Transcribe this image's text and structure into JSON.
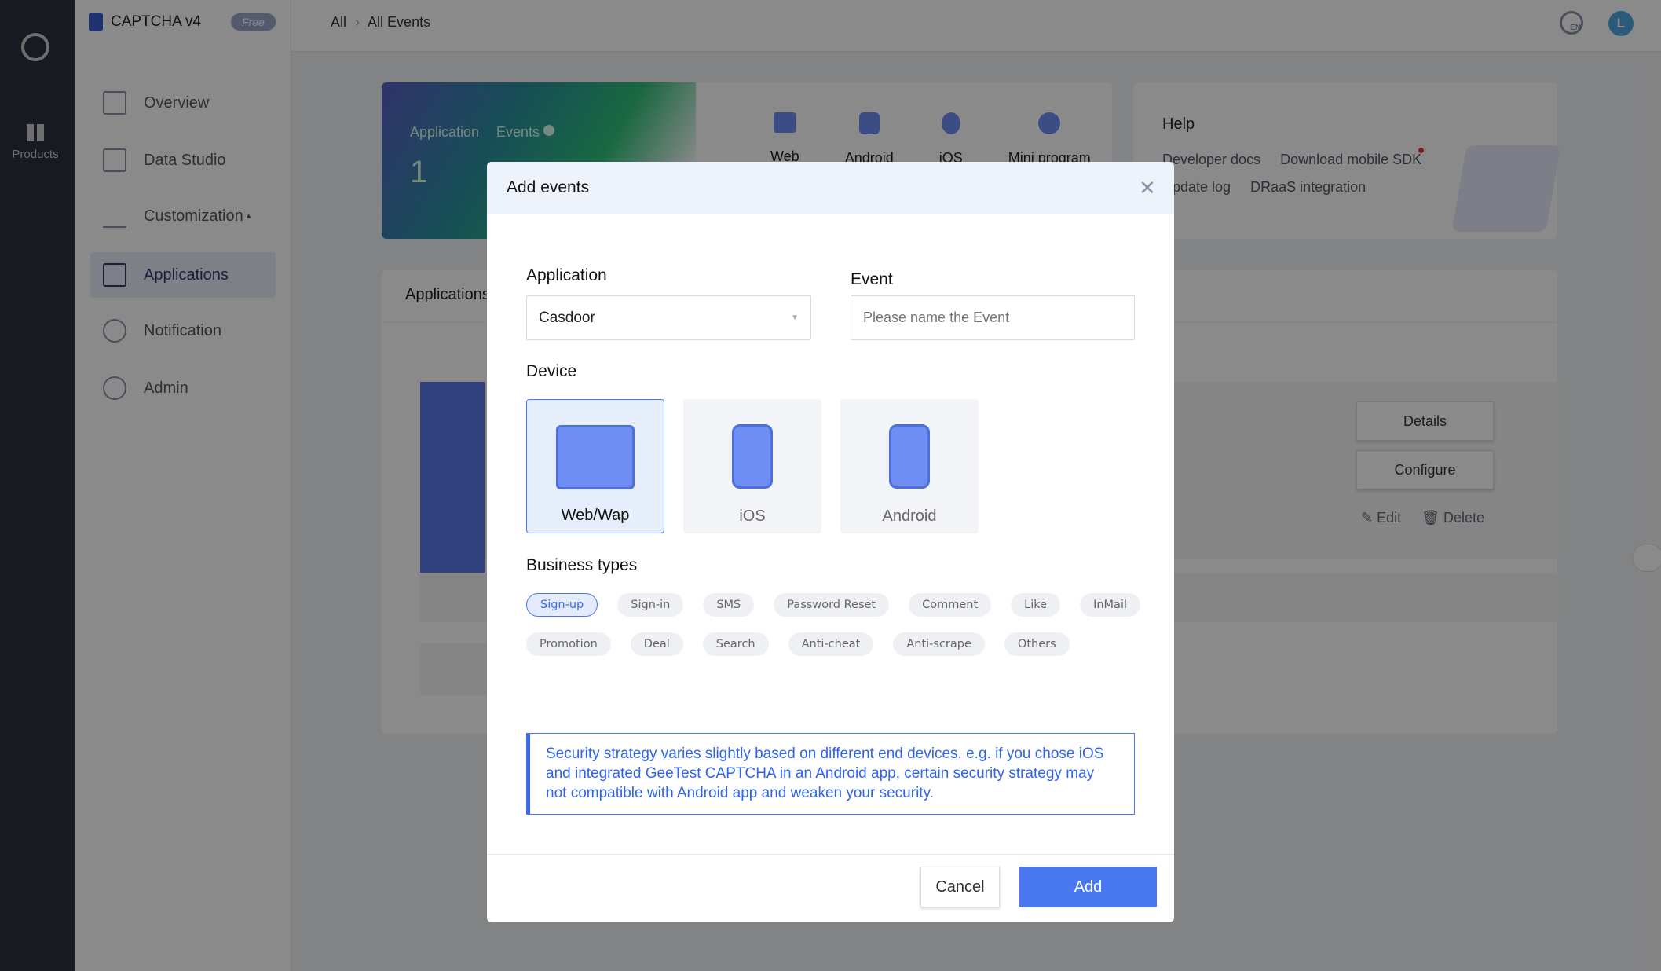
{
  "rail": {
    "products_label": "Products"
  },
  "header": {
    "product": "CAPTCHA v4",
    "plan_badge": "Free",
    "breadcrumb": [
      "All",
      "All Events"
    ],
    "lang": "EN",
    "avatar": "L"
  },
  "sidebar": {
    "items": [
      {
        "label": "Overview"
      },
      {
        "label": "Data Studio"
      },
      {
        "label": "Customization"
      },
      {
        "label": "Applications",
        "active": true
      },
      {
        "label": "Notification"
      },
      {
        "label": "Admin"
      }
    ]
  },
  "summary": {
    "application_label": "Application",
    "events_label": "Events",
    "application_count": "1",
    "platforms": [
      "Web",
      "Android",
      "iOS",
      "Mini program"
    ]
  },
  "help": {
    "title": "Help",
    "links": [
      "Developer docs",
      "Download mobile SDK",
      "Update log",
      "DRaaS integration"
    ]
  },
  "apps_panel": {
    "title": "Applications",
    "details": "Details",
    "configure": "Configure",
    "edit": "Edit",
    "delete": "Delete"
  },
  "modal": {
    "title": "Add events",
    "application_label": "Application",
    "application_value": "Casdoor",
    "event_label": "Event",
    "event_placeholder": "Please name the Event",
    "device_label": "Device",
    "devices": [
      {
        "label": "Web/Wap",
        "selected": true
      },
      {
        "label": "iOS"
      },
      {
        "label": "Android"
      }
    ],
    "business_label": "Business types",
    "business_types": [
      "Sign-up",
      "Sign-in",
      "SMS",
      "Password Reset",
      "Comment",
      "Like",
      "InMail",
      "Promotion",
      "Deal",
      "Search",
      "Anti-cheat",
      "Anti-scrape",
      "Others"
    ],
    "selected_business_type": "Sign-up",
    "info": "Security strategy varies slightly based on different end devices. e.g. if you chose iOS and integrated GeeTest CAPTCHA in an Android app, certain security strategy may not compatible with Android app and weaken your security.",
    "cancel": "Cancel",
    "add": "Add"
  },
  "colors": {
    "accent": "#3b6cf0",
    "rail": "#2b323d"
  }
}
